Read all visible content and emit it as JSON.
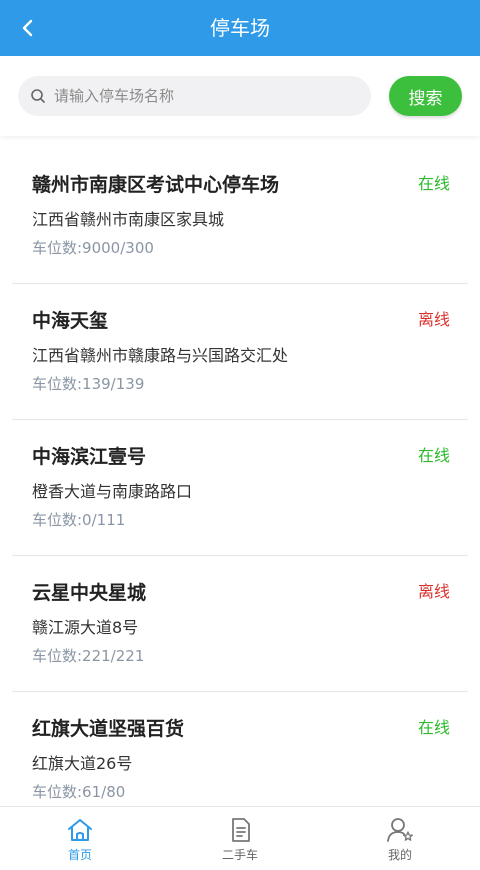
{
  "header": {
    "title": "停车场"
  },
  "search": {
    "placeholder": "请输入停车场名称",
    "button_label": "搜索"
  },
  "parking_list": [
    {
      "name": "赣州市南康区考试中心停车场",
      "status": "在线",
      "status_type": "online",
      "address": "江西省赣州市南康区家具城",
      "spaces": "车位数:9000/300"
    },
    {
      "name": "中海天玺",
      "status": "离线",
      "status_type": "offline",
      "address": "江西省赣州市赣康路与兴国路交汇处",
      "spaces": "车位数:139/139"
    },
    {
      "name": "中海滨江壹号",
      "status": "在线",
      "status_type": "online",
      "address": "橙香大道与南康路路口",
      "spaces": "车位数:0/111"
    },
    {
      "name": "云星中央星城",
      "status": "离线",
      "status_type": "offline",
      "address": "赣江源大道8号",
      "spaces": "车位数:221/221"
    },
    {
      "name": "红旗大道坚强百货",
      "status": "在线",
      "status_type": "online",
      "address": "红旗大道26号",
      "spaces": "车位数:61/80"
    }
  ],
  "tabbar": {
    "items": [
      {
        "label": "首页",
        "icon": "home-icon",
        "active": true
      },
      {
        "label": "二手车",
        "icon": "document-icon",
        "active": false
      },
      {
        "label": "我的",
        "icon": "user-icon",
        "active": false
      }
    ]
  },
  "colors": {
    "primary": "#2e9ae8",
    "search_button": "#3cbf3c",
    "online": "#2db92d",
    "offline": "#d9322e"
  }
}
